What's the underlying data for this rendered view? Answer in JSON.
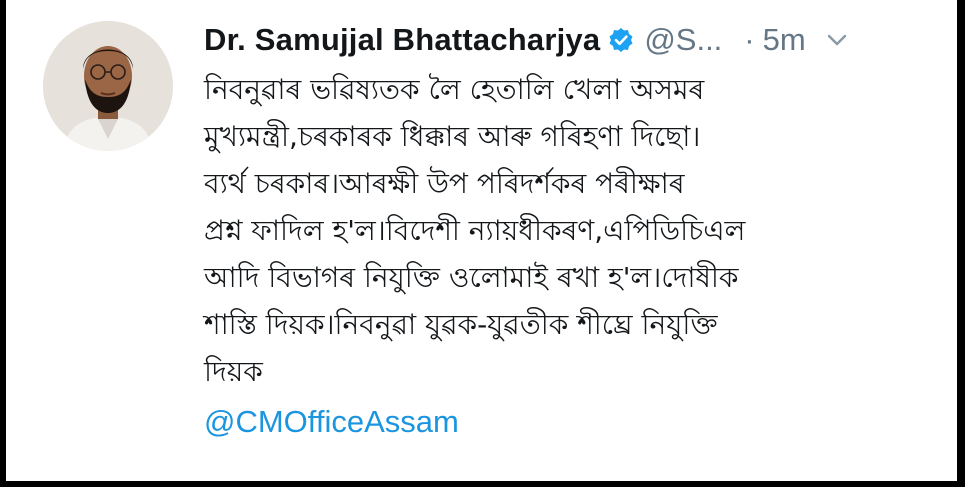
{
  "tweet": {
    "author_name": "Dr. Samujjal Bhattacharjya",
    "handle": "@S...",
    "separator": "·",
    "time": "5m",
    "lines": [
      "নিবনুৱাৰ ভৱিষ্যতক লৈ হেতালি খেলা অসমৰ",
      "মুখ্যমন্ত্ৰী,চৰকাৰক ধিক্কাৰ আৰু গৰিহণা দিছো।",
      "ব্যৰ্থ চৰকাৰ।আৰক্ষী উপ পৰিদৰ্শকৰ পৰীক্ষাৰ",
      "প্ৰশ্ন ফাদিল হ'ল।বিদেশী ন্যায়ধীকৰণ,এপিডিচিএল",
      "আদি বিভাগৰ নিযুক্তি ওলোমাই ৰখা হ'ল।দোষীক",
      "শাস্তি দিয়ক।নিবনুৱা যুৱক-যুৱতীক শীঘ্ৰে নিযুক্তি",
      "দিয়ক"
    ],
    "mention": "@CMOfficeAssam"
  },
  "icons": {
    "verified": "verified-badge-icon",
    "menu": "chevron-down-icon"
  },
  "colors": {
    "text": "#14171a",
    "secondary": "#657786",
    "link": "#1b95e0",
    "verified": "#1da1f2"
  }
}
